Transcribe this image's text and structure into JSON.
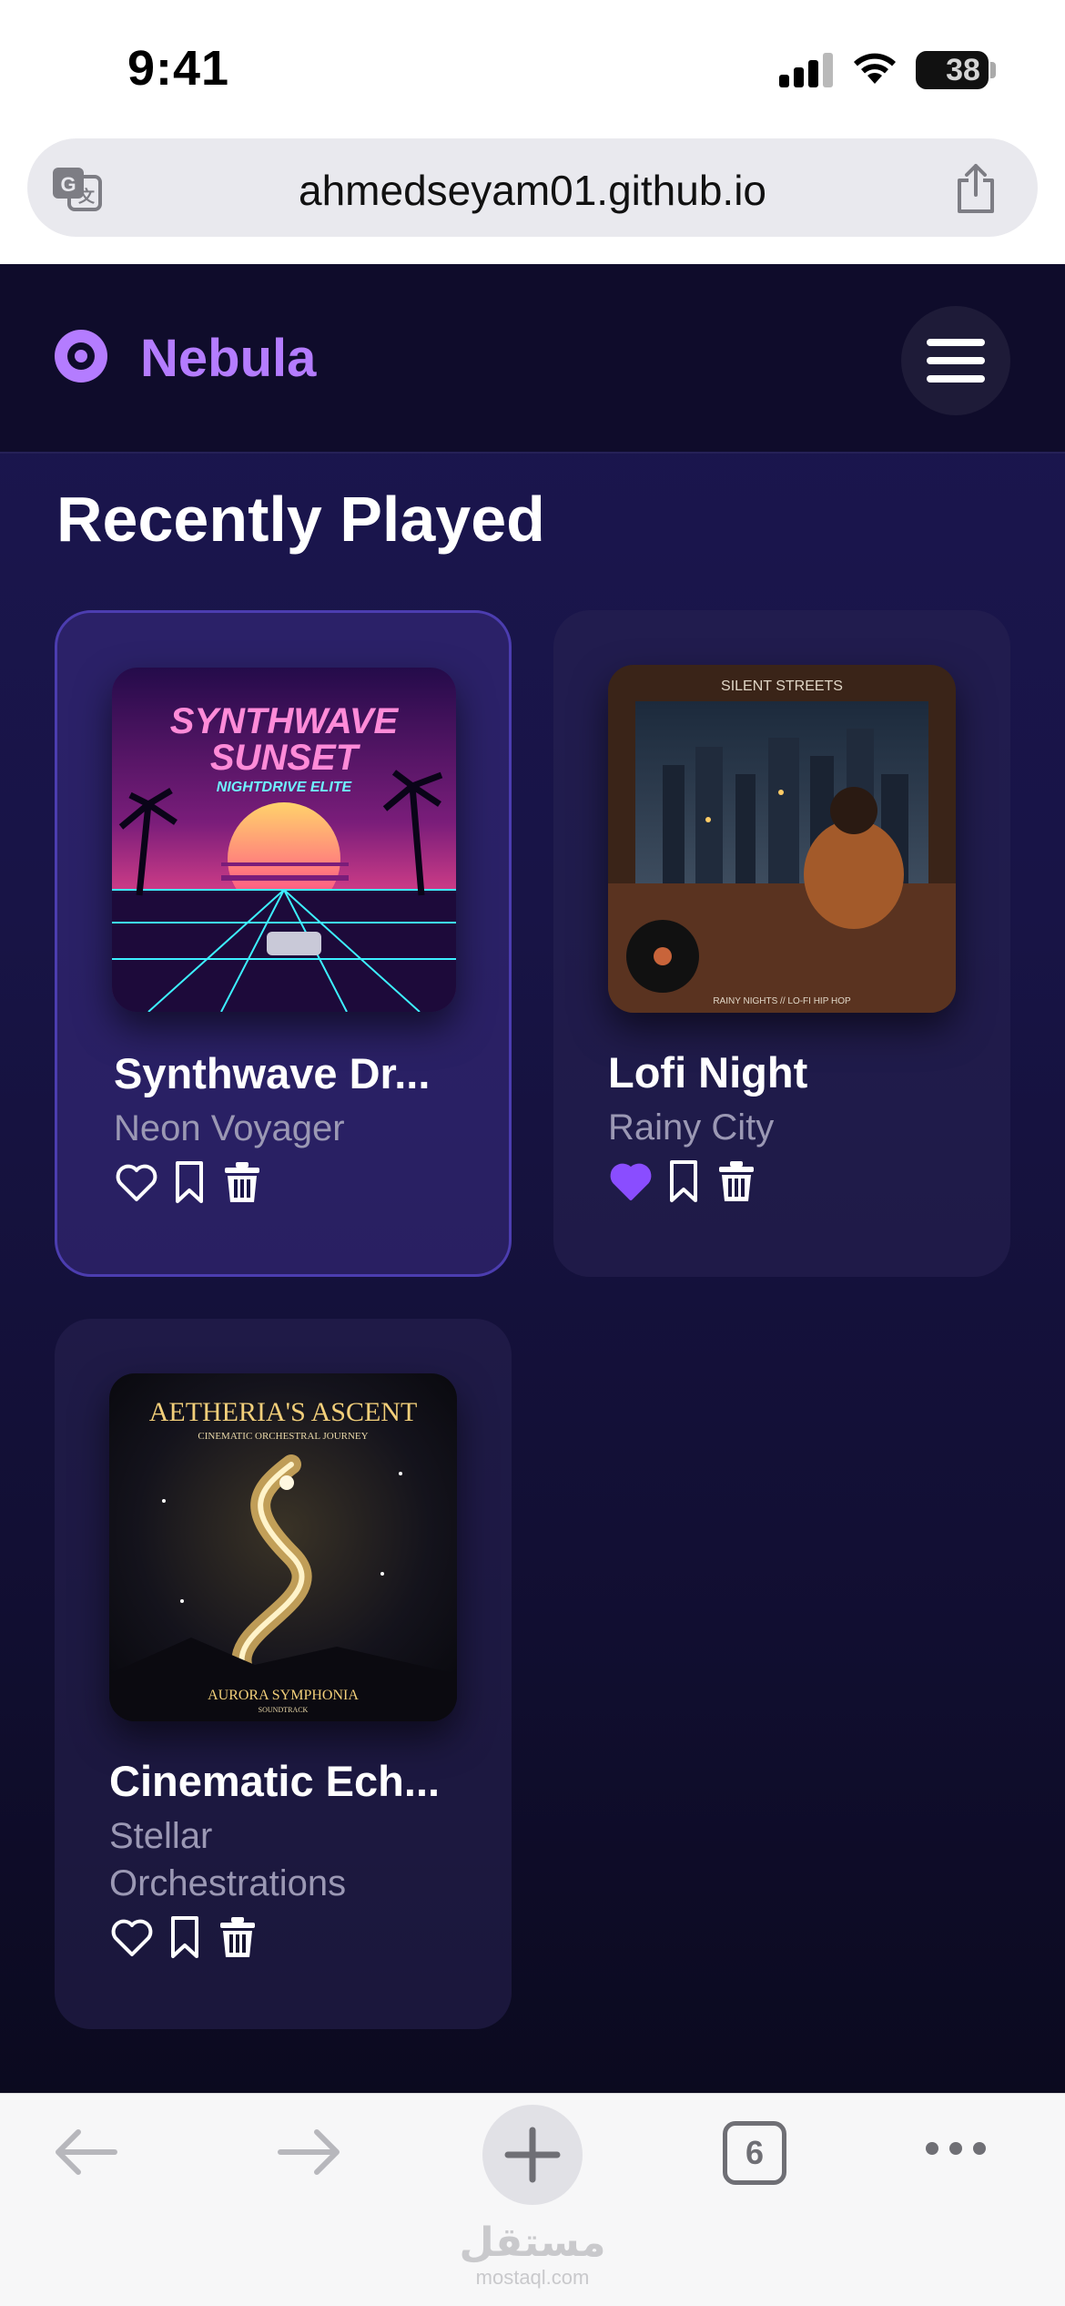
{
  "status_bar": {
    "time": "9:41",
    "battery_level": "38"
  },
  "browser": {
    "url": "ahmedseyam01.github.io",
    "tab_count": "6"
  },
  "app": {
    "name": "Nebula",
    "accent_color": "#b47cff",
    "liked_color": "#8a4dff",
    "section_title": "Recently Played",
    "tracks": [
      {
        "title": "Synthwave Dr...",
        "artist": "Neon Voyager",
        "liked": false,
        "art_text": "SYNTHWAVE SUNSET",
        "art_subtext": "NIGHTDRIVE ELITE"
      },
      {
        "title": "Lofi Night",
        "artist": "Rainy City",
        "liked": true,
        "art_text": "SILENT STREETS",
        "art_subtext": "RAINY NIGHTS // LO-FI HIP HOP"
      },
      {
        "title": "Cinematic Ech...",
        "artist": "Stellar Orchestrations",
        "liked": false,
        "art_text": "AETHERIA'S ASCENT",
        "art_subtext": "CINEMATIC ORCHESTRAL JOURNEY",
        "art_footer": "AURORA SYMPHONIA",
        "art_footer_sub": "SOUNDTRACK"
      }
    ]
  },
  "watermark": {
    "arabic": "مستقل",
    "latin": "mostaql.com"
  }
}
